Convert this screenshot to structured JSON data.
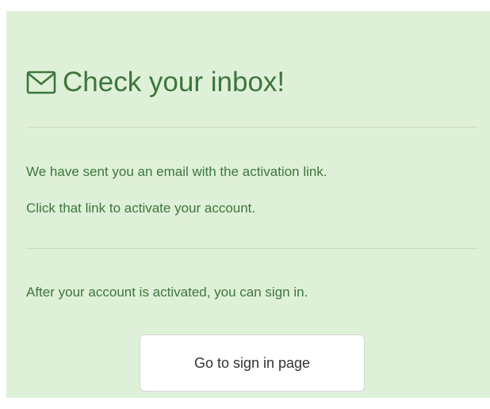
{
  "card": {
    "icon": "envelope-icon",
    "title": "Check your inbox!",
    "message_line1": "We have sent you an email with the activation link.",
    "message_line2": "Click that link to activate your account.",
    "after_activation": "After your account is activated, you can sign in.",
    "button_label": "Go to sign in page"
  },
  "colors": {
    "panel_background": "#dff0d8",
    "text": "#3c763d",
    "divider": "#c9dcc0",
    "button_background": "#ffffff",
    "button_border": "#d5d5d5",
    "button_text": "#333333"
  }
}
